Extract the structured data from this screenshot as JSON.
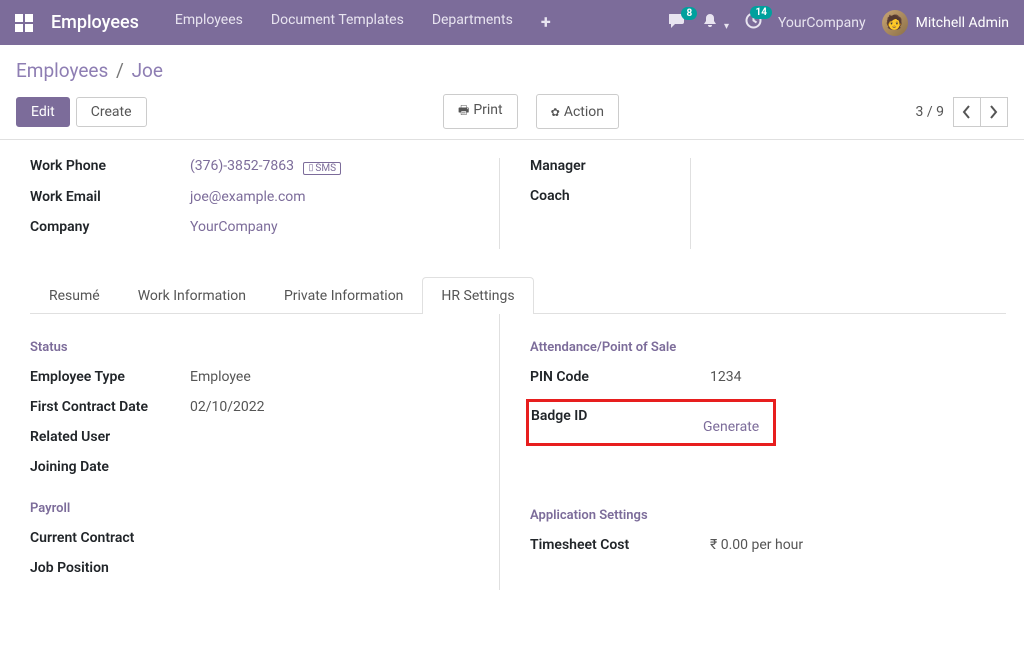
{
  "nav": {
    "brand": "Employees",
    "menu": [
      "Employees",
      "Document Templates",
      "Departments"
    ],
    "chat_badge": "8",
    "activity_badge": "14",
    "company": "YourCompany",
    "user": "Mitchell Admin"
  },
  "breadcrumb": {
    "parent": "Employees",
    "current": "Joe"
  },
  "toolbar": {
    "edit": "Edit",
    "create": "Create",
    "print": "Print",
    "action": "Action",
    "pager": "3 / 9"
  },
  "top_fields": {
    "work_phone_label": "Work Phone",
    "work_phone": "(376)-3852-7863",
    "sms": "SMS",
    "work_email_label": "Work Email",
    "work_email": "joe@example.com",
    "company_label": "Company",
    "company": "YourCompany",
    "manager_label": "Manager",
    "coach_label": "Coach"
  },
  "tabs": [
    "Resumé",
    "Work Information",
    "Private Information",
    "HR Settings"
  ],
  "status": {
    "heading": "Status",
    "employee_type_label": "Employee Type",
    "employee_type": "Employee",
    "first_contract_label": "First Contract Date",
    "first_contract": "02/10/2022",
    "related_user_label": "Related User",
    "joining_date_label": "Joining Date"
  },
  "attendance": {
    "heading": "Attendance/Point of Sale",
    "pin_label": "PIN Code",
    "pin": "1234",
    "badge_label": "Badge ID",
    "generate": "Generate"
  },
  "payroll": {
    "heading": "Payroll",
    "current_contract_label": "Current Contract",
    "job_position_label": "Job Position"
  },
  "appsettings": {
    "heading": "Application Settings",
    "timesheet_label": "Timesheet Cost",
    "timesheet_value": "₹ 0.00 per hour"
  }
}
